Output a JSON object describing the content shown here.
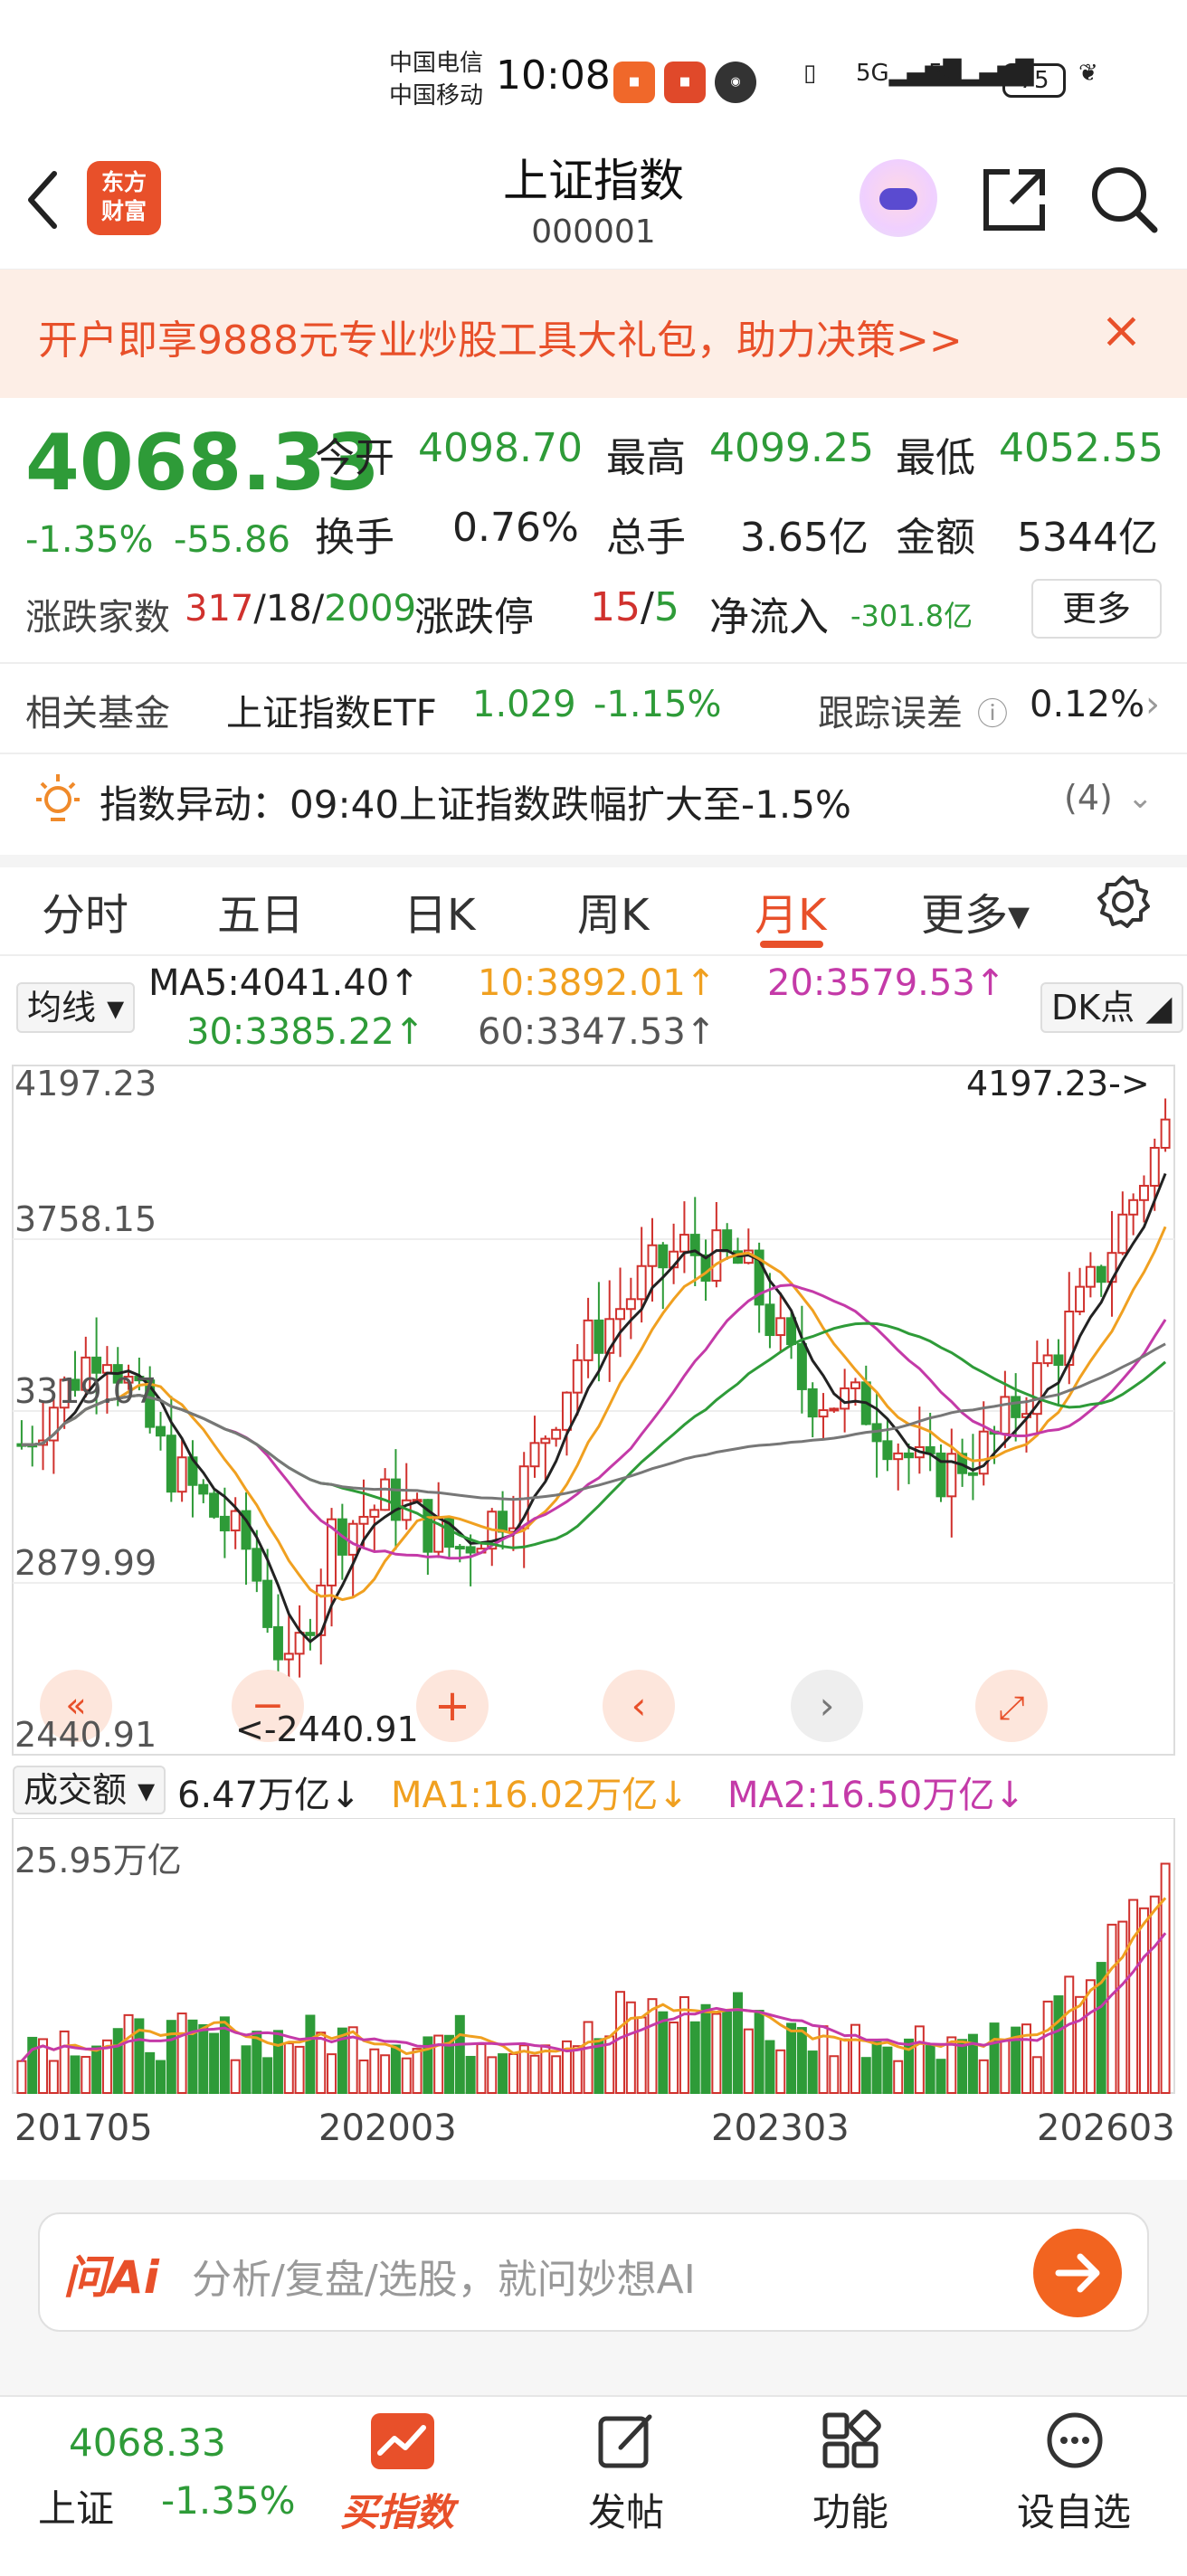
{
  "status_bar": {
    "carrier1": "中国电信",
    "carrier2": "中国移动",
    "time": "10:08",
    "battery": "75"
  },
  "header": {
    "logo_line1": "东方",
    "logo_line2": "财富",
    "title": "上证指数",
    "code": "000001"
  },
  "banner": {
    "text": "开户即享9888元专业炒股工具大礼包，助力决策>>",
    "close": "×"
  },
  "quote": {
    "price": "4068.33",
    "change_pct": "-1.35%",
    "change_abs": "-55.86",
    "open_label": "今开",
    "open": "4098.70",
    "high_label": "最高",
    "high": "4099.25",
    "low_label": "最低",
    "low": "4052.55",
    "turnover_label": "换手",
    "turnover": "0.76%",
    "volume_label": "总手",
    "volume": "3.65亿",
    "amount_label": "金额",
    "amount": "5344亿",
    "breadth_label": "涨跌家数",
    "breadth_up": "317",
    "breadth_flat": "18",
    "breadth_down": "2009",
    "limit_label": "涨跌停",
    "limit_up": "15",
    "limit_down": "5",
    "netflow_label": "净流入",
    "netflow": "-301.8亿",
    "more": "更多"
  },
  "fund": {
    "label": "相关基金",
    "name": "上证指数ETF",
    "price": "1.029",
    "change": "-1.15%",
    "tracking_label": "跟踪误差",
    "tracking": "0.12%"
  },
  "alert": {
    "text": "指数异动：09:40上证指数跌幅扩大至-1.5%",
    "count": "(4)"
  },
  "tabs": [
    "分时",
    "五日",
    "日K",
    "周K",
    "月K",
    "更多▾"
  ],
  "ma": {
    "selector": "均线",
    "ma5": "MA5:4041.40↑",
    "ma10": "10:3892.01↑",
    "ma20": "20:3579.53↑",
    "ma30": "30:3385.22↑",
    "ma60": "60:3347.53↑",
    "dk": "DK点"
  },
  "price_axis": {
    "top": "4197.23",
    "l2": "3758.15",
    "l3": "3319.07",
    "l4": "2879.99",
    "bottom": "2440.91",
    "max_marker": "4197.23->",
    "min_marker": "<-2440.91"
  },
  "volume": {
    "selector": "成交额",
    "value": "6.47万亿↓",
    "ma1": "MA1:16.02万亿↓",
    "ma2": "MA2:16.50万亿↓",
    "axis_top": "25.95万亿"
  },
  "dates": [
    "201705",
    "202003",
    "202303",
    "202603"
  ],
  "ai": {
    "logo": "问Ai",
    "placeholder": "分析/复盘/选股，就问妙想AI"
  },
  "bottom_bar": {
    "price": "4068.33",
    "name": "上证",
    "change": "-1.35%",
    "buy": "买指数",
    "post": "发帖",
    "func": "功能",
    "watch": "设自选"
  },
  "colors": {
    "up": "#d0312d",
    "down": "#2e9b38",
    "accent": "#e8502a"
  },
  "chart_data": {
    "type": "candlestick",
    "period": "monthly",
    "ylim": [
      2440.91,
      4197.23
    ],
    "max_marker": 4197.23,
    "min_marker": 2440.91,
    "x_tick_labels": [
      "201705",
      "202003",
      "202303",
      "202603"
    ],
    "volume_axis_top": "25.95万亿"
  }
}
